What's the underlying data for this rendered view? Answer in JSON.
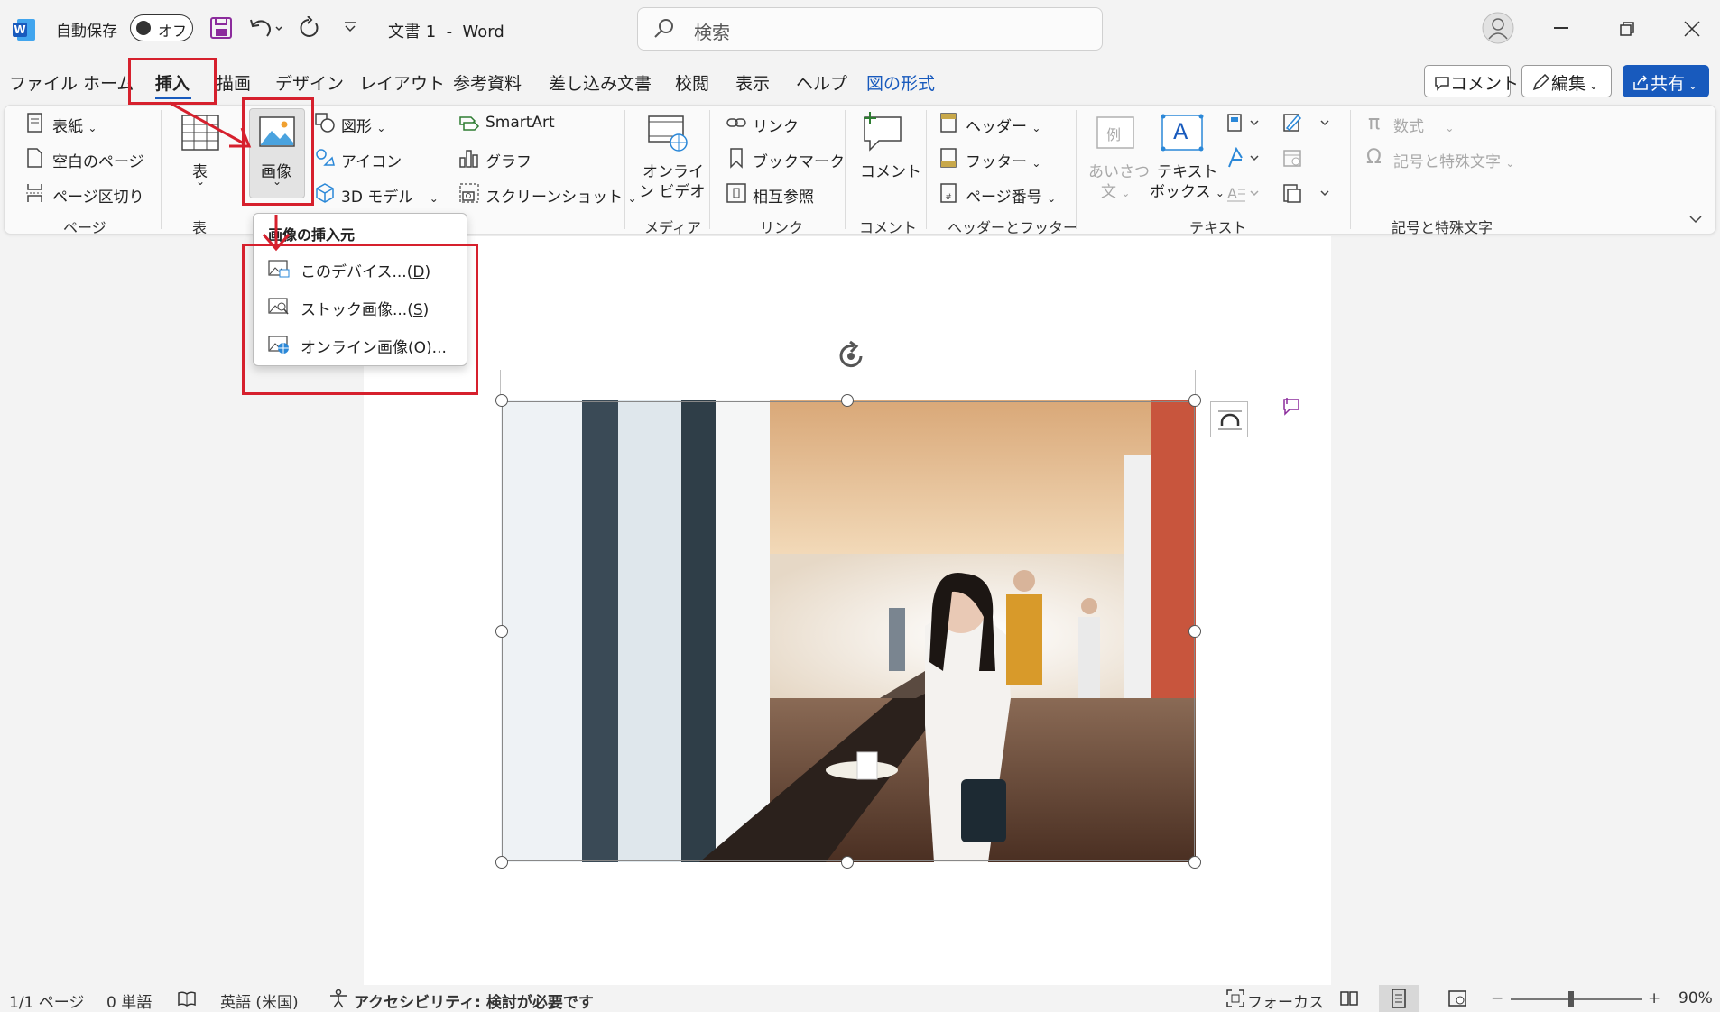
{
  "titlebar": {
    "autosave_label": "自動保存",
    "autosave_state": "オフ",
    "doc_title": "文書 1  -  Word",
    "search_placeholder": "検索"
  },
  "tabs": [
    {
      "label": "ファイル"
    },
    {
      "label": "ホーム"
    },
    {
      "label": "挿入",
      "active": true
    },
    {
      "label": "描画"
    },
    {
      "label": "デザイン"
    },
    {
      "label": "レイアウト"
    },
    {
      "label": "参考資料"
    },
    {
      "label": "差し込み文書"
    },
    {
      "label": "校閲"
    },
    {
      "label": "表示"
    },
    {
      "label": "ヘルプ"
    },
    {
      "label": "図の形式",
      "accent": true
    }
  ],
  "top_buttons": {
    "comment": "コメント",
    "edit": "編集",
    "share": "共有"
  },
  "ribbon": {
    "pages": {
      "cover": "表紙",
      "blank": "空白のページ",
      "break": "ページ区切り",
      "group": "ページ"
    },
    "table": {
      "label": "表",
      "group": "表"
    },
    "image": {
      "label": "画像"
    },
    "illustrations": {
      "shapes": "図形",
      "icons": "アイコン",
      "model3d": "3D モデル",
      "smartart": "SmartArt",
      "chart": "グラフ",
      "screenshot": "スクリーンショット"
    },
    "media": {
      "online_video_1": "オンライ",
      "online_video_2": "ン ビデオ",
      "group": "メディア"
    },
    "links": {
      "link": "リンク",
      "bookmark": "ブックマーク",
      "crossref": "相互参照",
      "group": "リンク"
    },
    "comments": {
      "comment": "コメント",
      "group": "コメント"
    },
    "header_footer": {
      "header": "ヘッダー",
      "footer": "フッター",
      "page_number": "ページ番号",
      "group": "ヘッダーとフッター"
    },
    "text": {
      "greeting_icon": "例",
      "greeting_1": "あいさつ",
      "greeting_2": "文",
      "textbox_icon": "A",
      "textbox_1": "テキスト",
      "textbox_2": "ボックス",
      "group": "テキスト"
    },
    "symbols": {
      "equation": "数式",
      "symbol": "記号と特殊文字",
      "group": "記号と特殊文字"
    }
  },
  "menu": {
    "title": "画像の挿入元",
    "items": [
      {
        "text": "このデバイス...(",
        "key": "D",
        "close": ")"
      },
      {
        "text": "ストック画像...(",
        "key": "S",
        "close": ")"
      },
      {
        "text": "オンライン画像(",
        "key": "O",
        "close": ")..."
      }
    ]
  },
  "status": {
    "page": "1/1 ページ",
    "words": "0 単語",
    "language": "英語 (米国)",
    "accessibility": "アクセシビリティ: 検討が必要です",
    "focus": "フォーカス",
    "zoom": "90%"
  },
  "colors": {
    "accent": "#185abd",
    "highlight": "#d6202d",
    "ribbon": "#fafafa"
  }
}
